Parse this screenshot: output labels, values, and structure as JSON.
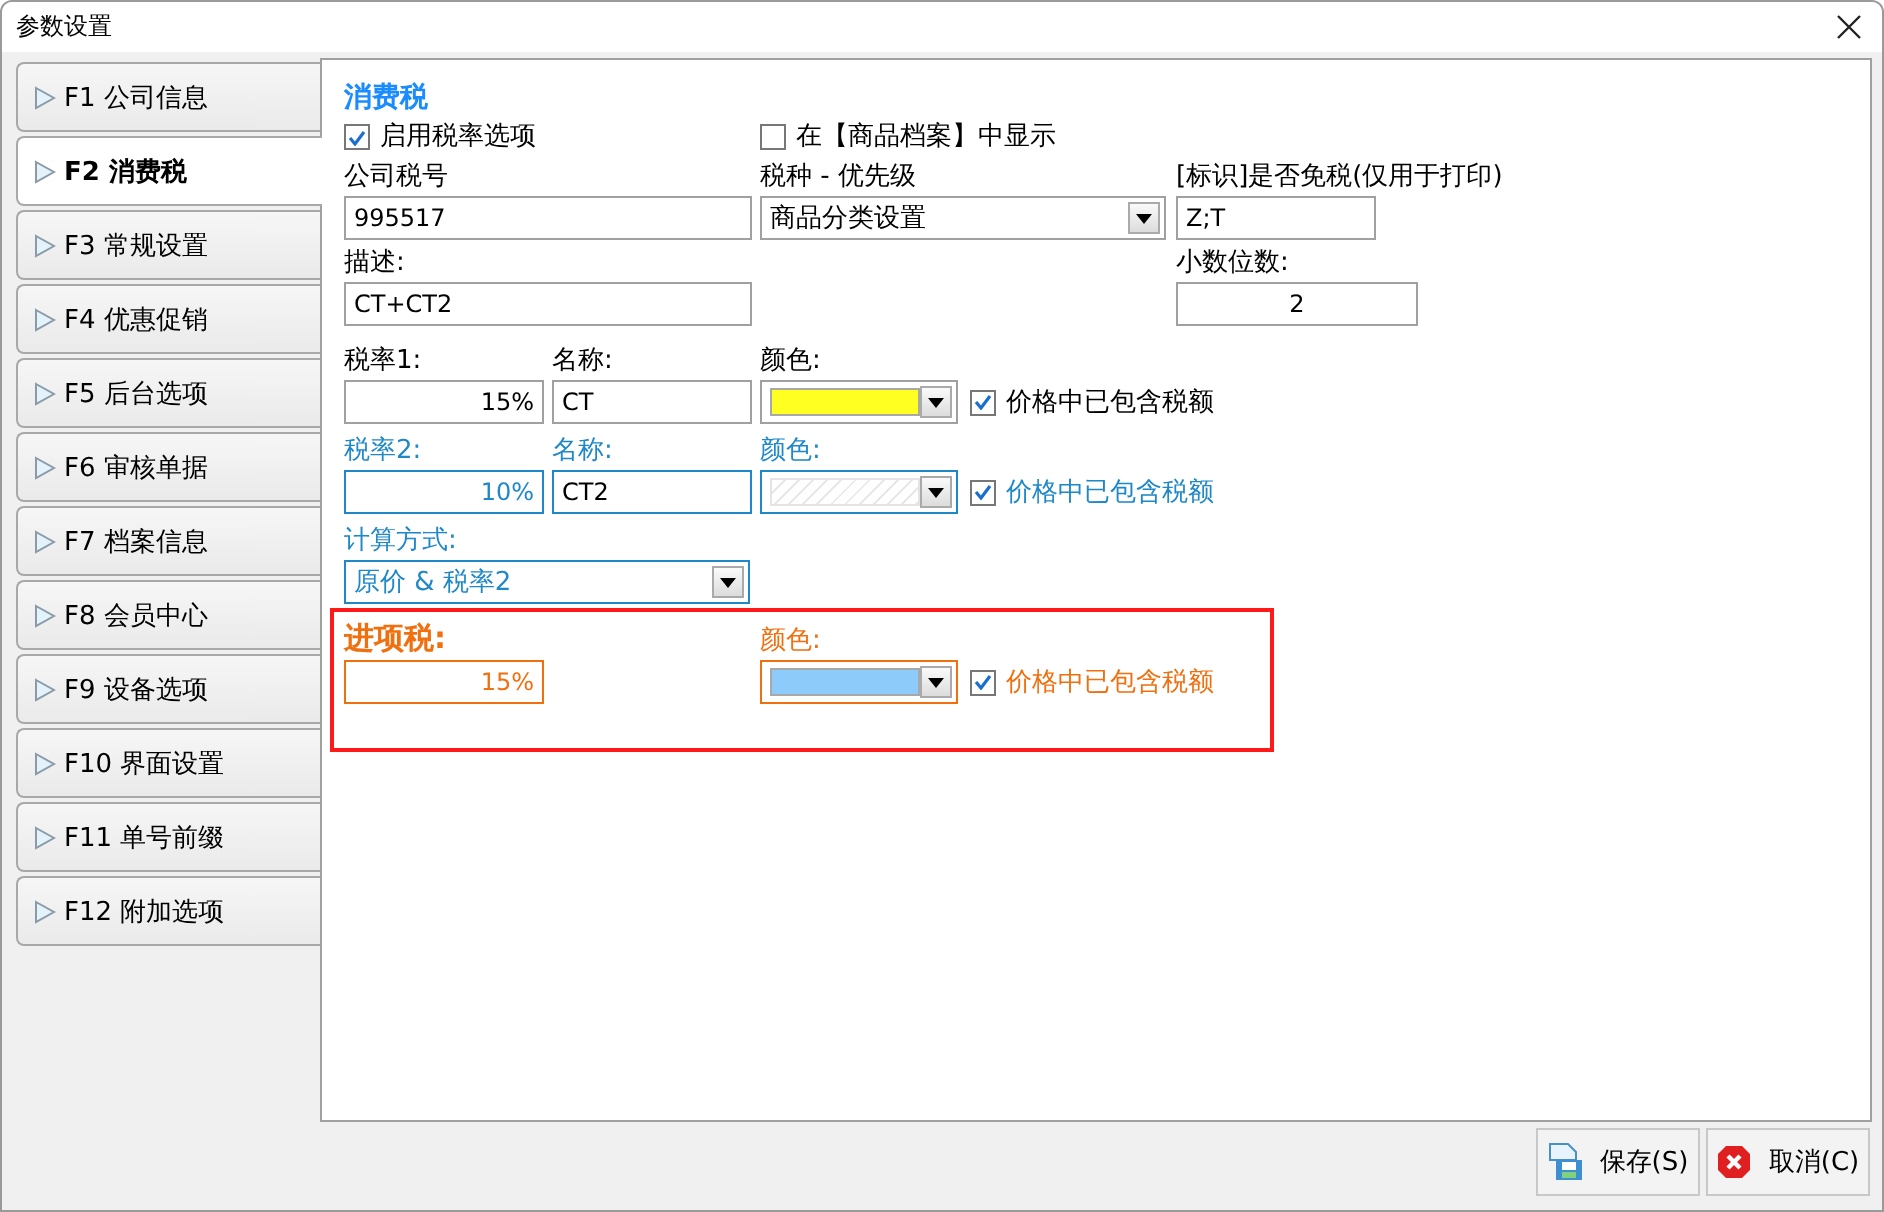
{
  "window": {
    "title": "参数设置"
  },
  "tabs": [
    {
      "label": "F1 公司信息",
      "selected": false
    },
    {
      "label": "F2 消费税",
      "selected": true
    },
    {
      "label": "F3 常规设置",
      "selected": false
    },
    {
      "label": "F4 优惠促销",
      "selected": false
    },
    {
      "label": "F5 后台选项",
      "selected": false
    },
    {
      "label": "F6 审核单据",
      "selected": false
    },
    {
      "label": "F7 档案信息",
      "selected": false
    },
    {
      "label": "F8 会员中心",
      "selected": false
    },
    {
      "label": "F9 设备选项",
      "selected": false
    },
    {
      "label": "F10 界面设置",
      "selected": false
    },
    {
      "label": "F11 单号前缀",
      "selected": false
    },
    {
      "label": "F12 附加选项",
      "selected": false
    }
  ],
  "section_title": "消费税",
  "options": [
    {
      "label": "启用税率选项",
      "checked": true
    },
    {
      "label": "在【商品档案】中显示",
      "checked": false
    }
  ],
  "company_tax_no": {
    "label": "公司税号",
    "value": "995517"
  },
  "tax_priority": {
    "label": "税种 - 优先级",
    "value": "商品分类设置"
  },
  "exempt_flag": {
    "label": "[标识]是否免税(仅用于打印)",
    "value": "Z;T"
  },
  "description": {
    "label": "描述:",
    "value": "CT+CT2"
  },
  "decimals": {
    "label": "小数位数:",
    "value": "2"
  },
  "rates": [
    {
      "rate_label": "税率1:",
      "rate": "15%",
      "name_label": "名称:",
      "name": "CT",
      "color_label": "颜色:",
      "color": "#ffff22",
      "included_label": "价格中已包含税额",
      "included": true,
      "accent": false
    },
    {
      "rate_label": "税率2:",
      "rate": "10%",
      "name_label": "名称:",
      "name": "CT2",
      "color_label": "颜色:",
      "included_label": "价格中已包含税额",
      "included": true,
      "accent": true
    }
  ],
  "calc_method": {
    "label": "计算方式:",
    "value": "原价 & 税率2"
  },
  "input_tax": {
    "label": "进项税:",
    "rate": "15%",
    "color_label": "颜色:",
    "color": "#8ccbfa",
    "included_label": "价格中已包含税额",
    "included": true
  },
  "buttons": [
    {
      "label": "保存(S)",
      "kind": "save"
    },
    {
      "label": "取消(C)",
      "kind": "cancel"
    }
  ]
}
